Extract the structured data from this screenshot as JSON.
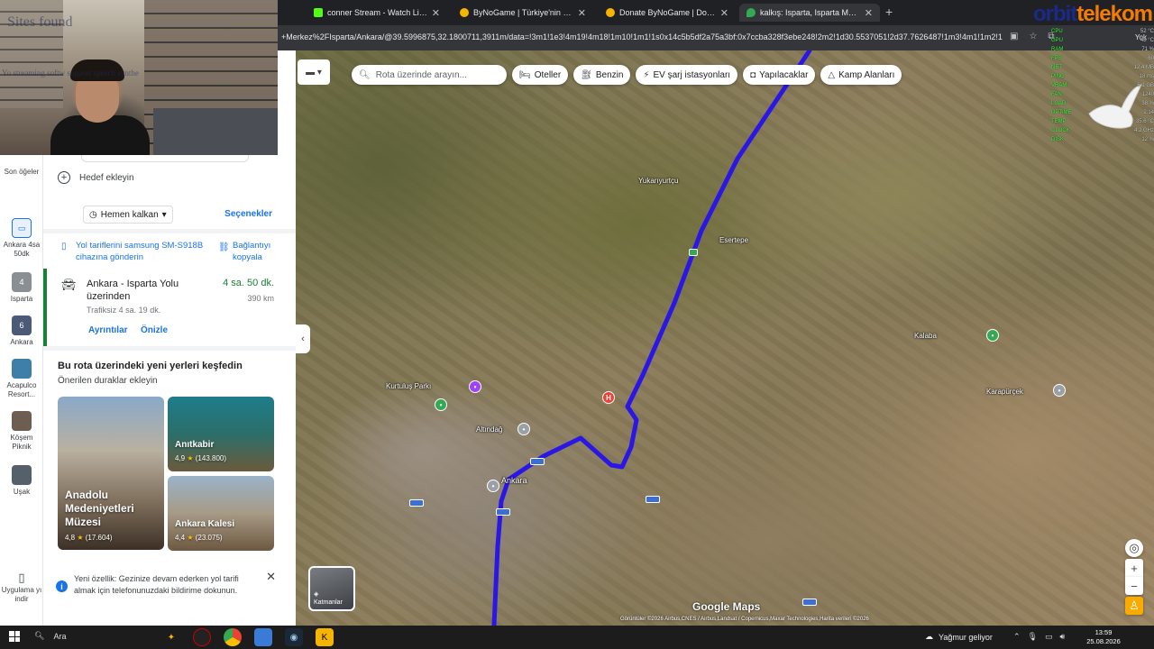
{
  "browser": {
    "tabs": [
      {
        "title": "conner Stream - Watch Live on",
        "color": "#53fc18"
      },
      {
        "title": "ByNoGame | Türkiye'nin En Büy",
        "color": "#f4b400"
      },
      {
        "title": "Donate ByNoGame | Donations",
        "color": "#f4b400"
      },
      {
        "title": "kalkış: Isparta, Isparta Merkez/I",
        "color": "#34a853"
      }
    ],
    "url": "+Merkez%2FIsparta/Ankara/@39.5996875,32.1800711,3911m/data=!3m1!1e3!4m19!4m18!1m10!1m1!1s0x14c5b5df2a75a3bf:0x7ccba328f3ebe248!2m2!1d30.5537051!2d37.7626487!1m3!4m1!1m2!1...",
    "profile_label": "Yok"
  },
  "overlay": {
    "brand_part1": "orbit",
    "brand_part2": "telekom",
    "ghost_title": "Sites found",
    "ghost_line": "Yo streaming softw        support speech synthe",
    "stats": [
      {
        "label": "CPU",
        "value": "52 °C"
      },
      {
        "label": "GPU",
        "value": "48 °C"
      },
      {
        "label": "RAM",
        "value": "71 %"
      },
      {
        "label": "FPS",
        "value": "60"
      },
      {
        "label": "NET",
        "value": "12.4 MB"
      },
      {
        "label": "PING",
        "value": "18 ms"
      },
      {
        "label": "VRAM",
        "value": "6.1 GB"
      },
      {
        "label": "FAN",
        "value": "1240"
      },
      {
        "label": "LOAD",
        "value": "38 %"
      },
      {
        "label": "UPTIME",
        "value": "2:14"
      },
      {
        "label": "TEMP",
        "value": "35.6 °C"
      },
      {
        "label": "CLOCK",
        "value": "4.2 GHz"
      },
      {
        "label": "DISK",
        "value": "12 %"
      }
    ]
  },
  "rail": {
    "recent_label": "Son öğeler",
    "items": [
      {
        "label": "Ankara 4sa 50dk"
      },
      {
        "label": "Isparta"
      },
      {
        "label": "Ankara"
      },
      {
        "label": "Acapulco Resort..."
      },
      {
        "label": "Köşem Piknik"
      },
      {
        "label": "Uşak"
      }
    ],
    "app_download": "Uygulama yı indir"
  },
  "panel": {
    "add_destination": "Hedef ekleyin",
    "leave_now": "Hemen kalkan",
    "options": "Seçenekler",
    "send_directions": "Yol tariflerini samsung SM-S918B cihazına gönderin",
    "copy_link": "Bağlantıyı kopyala",
    "route": {
      "title": "Ankara - Isparta Yolu üzerinden",
      "duration": "4 sa. 50 dk.",
      "distance": "390 km",
      "subtitle": "Trafiksiz 4 sa. 19 dk.",
      "details": "Ayrıntılar",
      "preview": "Önizle"
    },
    "explore_title": "Bu rota üzerindeki yeni yerleri keşfedin",
    "explore_subtitle": "Önerilen duraklar ekleyin",
    "places": [
      {
        "name": "Anadolu Medeniyetleri Müzesi",
        "rating": "4,8",
        "reviews": "(17.604)"
      },
      {
        "name": "Anıtkabir",
        "rating": "4,9",
        "reviews": "(143.800)"
      },
      {
        "name": "Ankara Kalesi",
        "rating": "4,4",
        "reviews": "(23.075)"
      }
    ],
    "notice": "Yeni özellik: Gezinize devam ederken yol tarifi almak için telefonunuzdaki bildirime dokunun."
  },
  "map": {
    "search_placeholder": "Rota üzerinde arayın...",
    "chips": [
      {
        "label": "Oteller",
        "icon": "bed-icon"
      },
      {
        "label": "Benzin",
        "icon": "fuel-icon"
      },
      {
        "label": "EV şarj istasyonları",
        "icon": "ev-charger-icon"
      },
      {
        "label": "Yapılacaklar",
        "icon": "camera-icon"
      },
      {
        "label": "Kamp Alanları",
        "icon": "tent-icon"
      }
    ],
    "labels": {
      "l1": "Kurtuluş Parkı",
      "l2": "Yukarıyurtçu",
      "l3": "Ankara",
      "l4": "Esertepe",
      "l5": "Kalaba",
      "l6": "Karapürçek",
      "l7": "Altındağ"
    },
    "logo": "Google Maps",
    "layers_label": "Katmanlar",
    "attribution": "Görüntüler ©2026 Airbus,CNES / Airbus,Landsat / Copernicus,Maxar Technologies,Harita verileri ©2026",
    "route_color": "#2a17e6"
  },
  "taskbar": {
    "search": "Ara",
    "weather": "Yağmur geliyor",
    "time": "13:59",
    "date": "25.08.2026"
  }
}
